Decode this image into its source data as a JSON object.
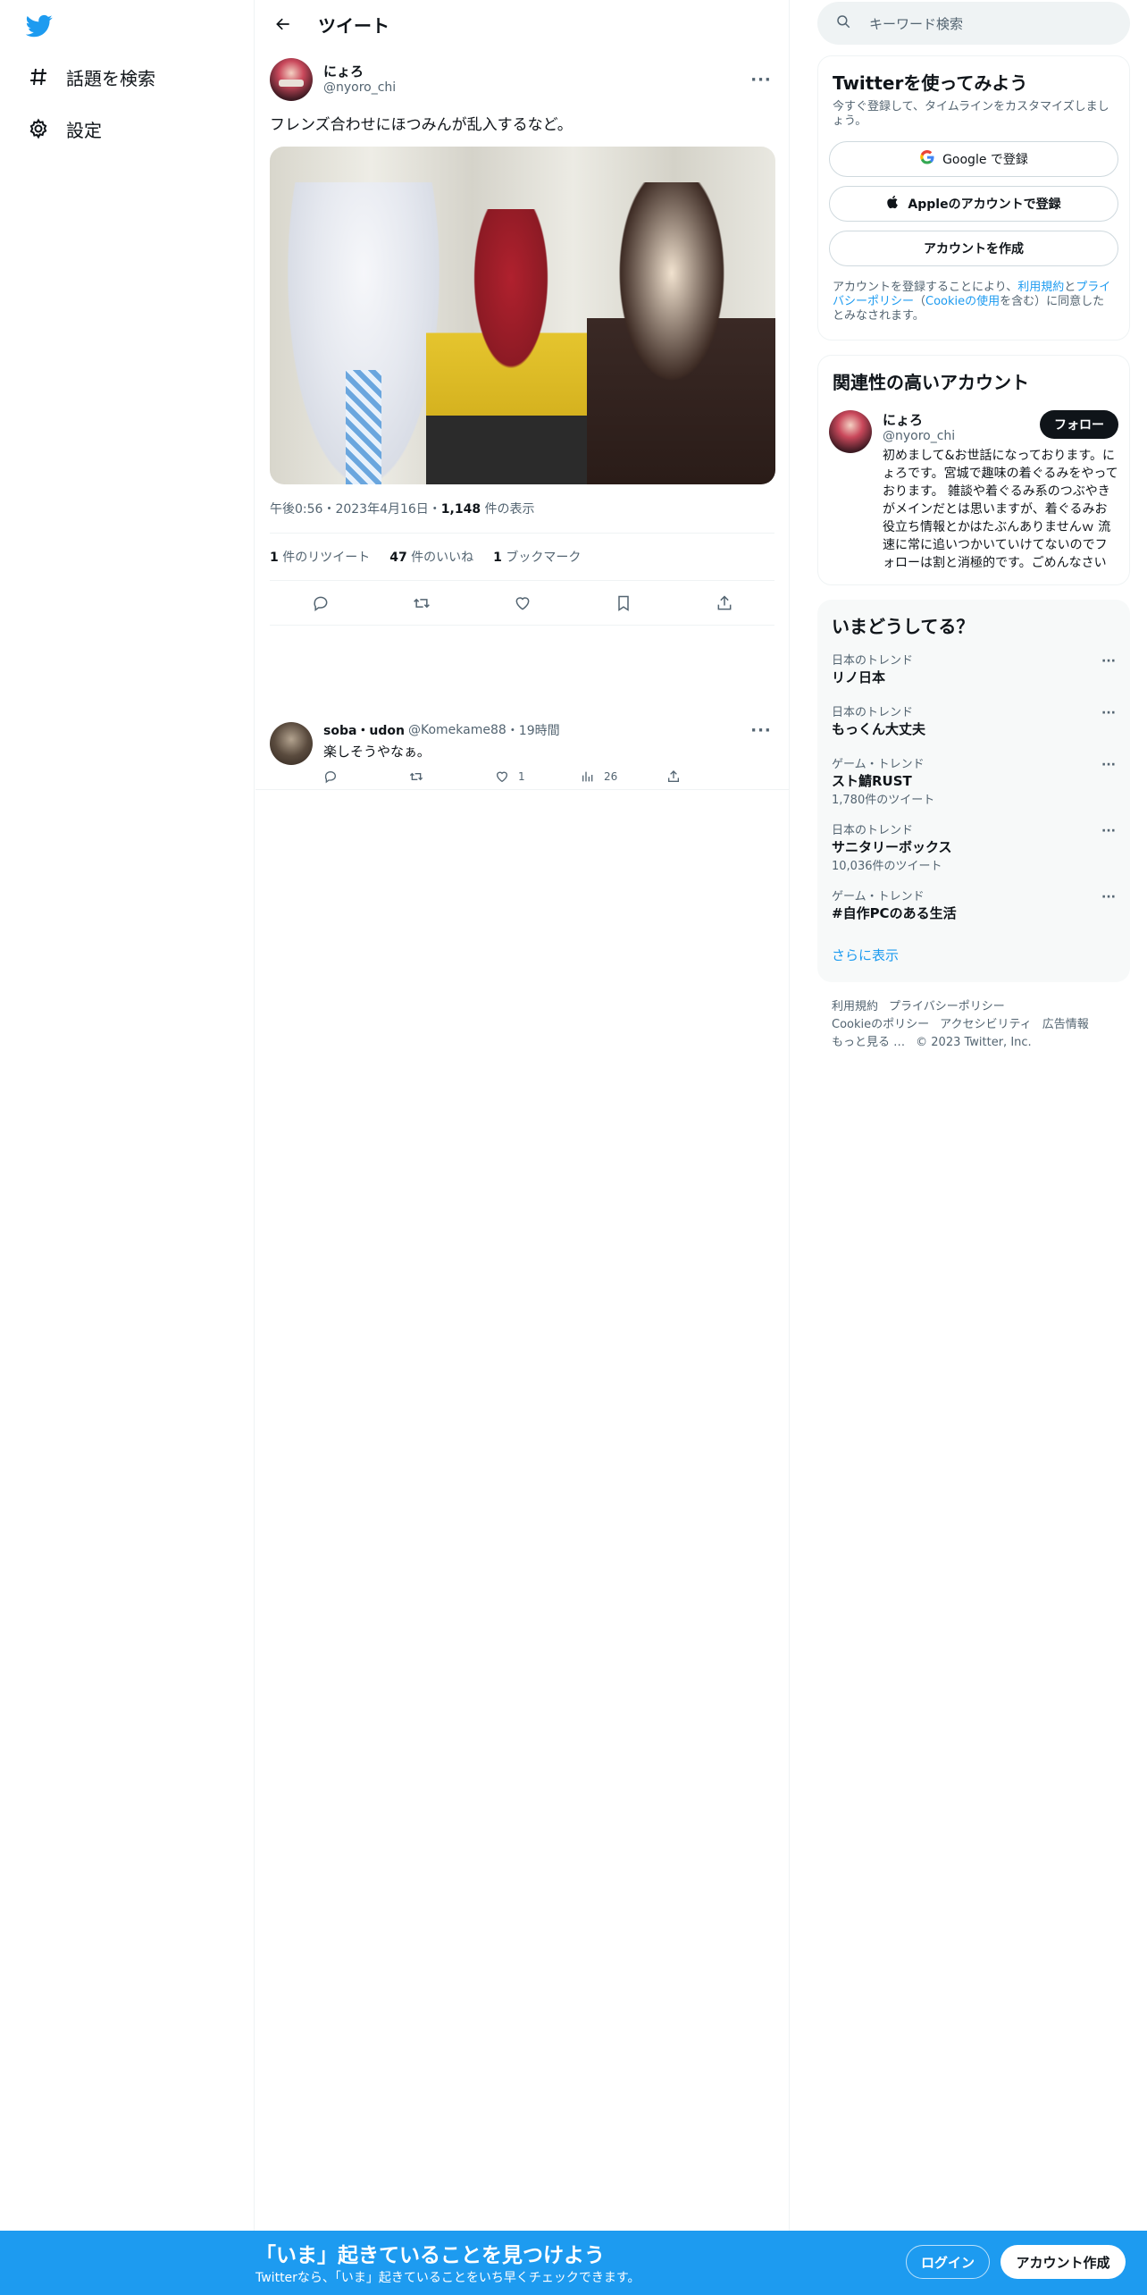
{
  "nav": {
    "logo": "twitter-bird-icon",
    "items": [
      {
        "label": "話題を検索",
        "icon": "hashtag-icon"
      },
      {
        "label": "設定",
        "icon": "gear-icon"
      }
    ]
  },
  "header": {
    "title": "ツイート"
  },
  "tweet": {
    "name": "にょろ",
    "handle": "@nyoro_chi",
    "text": "フレンズ合わせにほつみんが乱入するなど。",
    "time": "午後0:56・2023年4月16日・",
    "views_count": "1,148",
    "views_label": " 件の表示",
    "stats": {
      "retweets_count": "1",
      "retweets_label": " 件のリツイート",
      "likes_count": "47",
      "likes_label": " 件のいいね",
      "bookmarks_count": "1",
      "bookmarks_label": " ブックマーク"
    }
  },
  "reply": {
    "name": "soba・udon",
    "handle": "@Komekame88",
    "time": "・19時間",
    "text": "楽しそうやなぁ。",
    "likes": "1",
    "views": "26"
  },
  "sidebar": {
    "search_placeholder": "キーワード検索",
    "signup": {
      "title": "Twitterを使ってみよう",
      "subtitle": "今すぐ登録して、タイムラインをカスタマイズしましょう。",
      "google": "Google で登録",
      "apple": "Appleのアカウントで登録",
      "create": "アカウントを作成",
      "legal_1": "アカウントを登録することにより、",
      "legal_terms": "利用規約",
      "legal_2": "と",
      "legal_privacy": "プライバシーポリシー",
      "legal_3": "（",
      "legal_cookie": "Cookieの使用",
      "legal_4": "を含む）に同意したとみなされます。"
    },
    "related": {
      "title": "関連性の高いアカウント",
      "name": "にょろ",
      "handle": "@nyoro_chi",
      "follow": "フォロー",
      "bio": "初めまして&お世話になっております。にょろです。宮城で趣味の着ぐるみをやっております。 雑談や着ぐるみ系のつぶやきがメインだとは思いますが、着ぐるみお役立ち情報とかはたぶんありませんｗ 流速に常に追いつかいていけてないのでフォローは割と消極的です。ごめんなさい"
    },
    "trends": {
      "title": "いまどうしてる？",
      "items": [
        {
          "context": "日本のトレンド",
          "name": "リノ日本",
          "count": ""
        },
        {
          "context": "日本のトレンド",
          "name": "もっくん大丈夫",
          "count": ""
        },
        {
          "context": "ゲーム・トレンド",
          "name": "スト鯖RUST",
          "count": "1,780件のツイート"
        },
        {
          "context": "日本のトレンド",
          "name": "サニタリーボックス",
          "count": "10,036件のツイート"
        },
        {
          "context": "ゲーム・トレンド",
          "name": "#自作PCのある生活",
          "count": ""
        }
      ],
      "show_more": "さらに表示"
    },
    "footer": {
      "links": [
        "利用規約",
        "プライバシーポリシー",
        "Cookieのポリシー",
        "アクセシビリティ",
        "広告情報",
        "もっと見る …"
      ],
      "copyright": "© 2023 Twitter, Inc."
    }
  },
  "banner": {
    "headline": "「いま」起きていることを見つけよう",
    "subtext": "Twitterなら、「いま」起きていることをいち早くチェックできます。",
    "login": "ログイン",
    "signup": "アカウント作成"
  },
  "colors": {
    "accent": "#1d9bf0",
    "text": "#0f1419",
    "muted": "#536471"
  }
}
